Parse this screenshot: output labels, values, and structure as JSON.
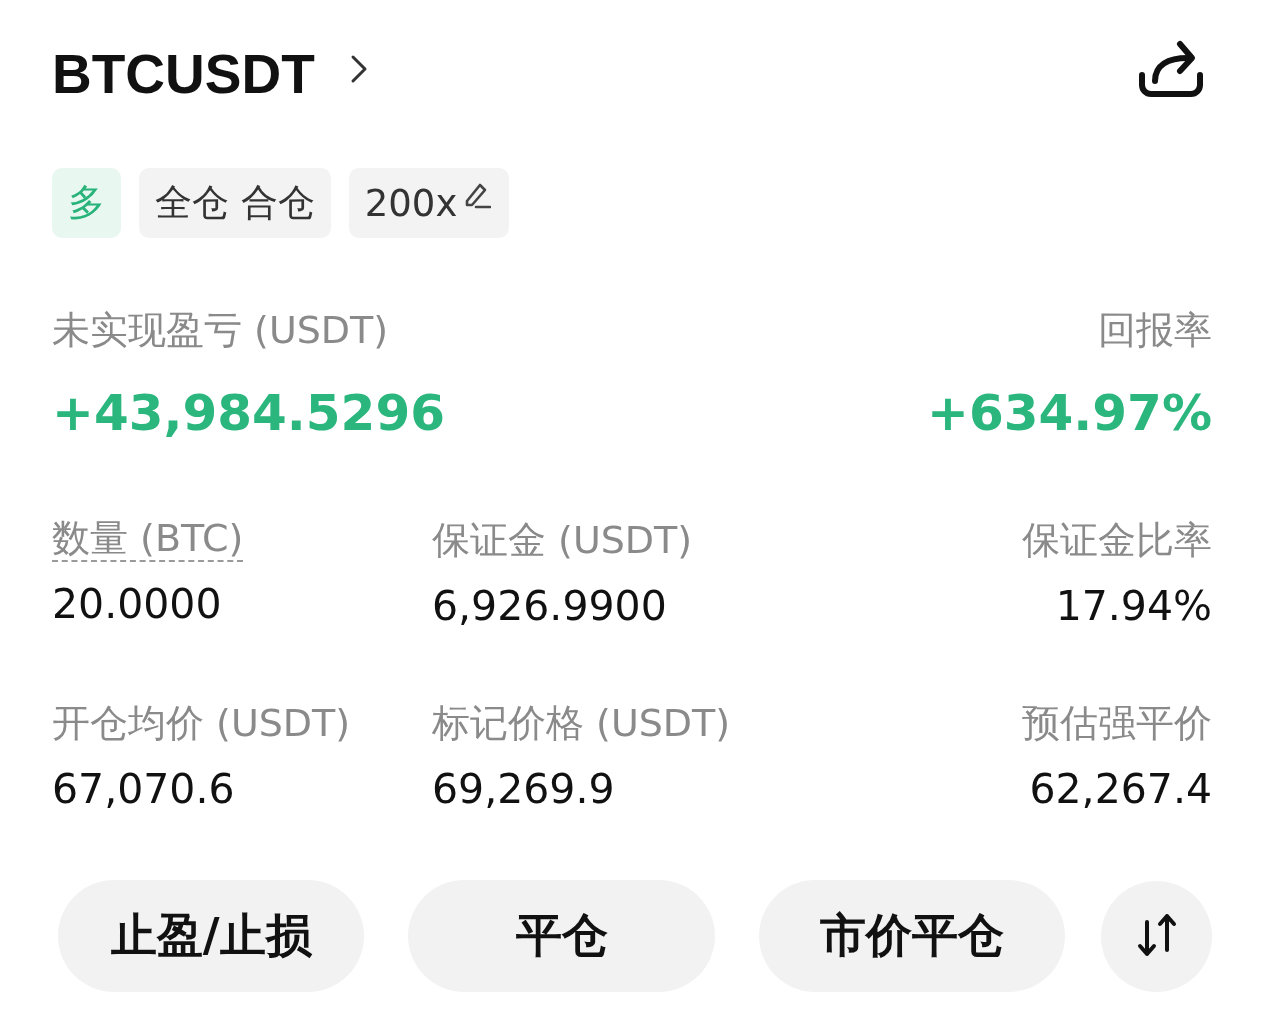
{
  "header": {
    "symbol": "BTCUSDT"
  },
  "tags": [
    {
      "kind": "side",
      "label": "多"
    },
    {
      "kind": "mode",
      "label": "全仓 合仓"
    },
    {
      "kind": "leverage",
      "label": "200x"
    }
  ],
  "summary": [
    {
      "label": "未实现盈亏 (USDT)",
      "value": "+43,984.5296"
    },
    {
      "label": "回报率",
      "value": "+634.97%"
    }
  ],
  "stats": [
    {
      "label": "数量 (BTC)",
      "value": "20.0000",
      "dashed_underline": true
    },
    {
      "label": "保证金 (USDT)",
      "value": "6,926.9900",
      "dashed_underline": false
    },
    {
      "label": "保证金比率",
      "value": "17.94%",
      "dashed_underline": false
    },
    {
      "label": "开仓均价 (USDT)",
      "value": "67,070.6",
      "dashed_underline": false
    },
    {
      "label": "标记价格 (USDT)",
      "value": "69,269.9",
      "dashed_underline": false
    },
    {
      "label": "预估强平价",
      "value": "62,267.4",
      "dashed_underline": false
    }
  ],
  "actions": [
    {
      "kind": "text",
      "label": "止盈/止损"
    },
    {
      "kind": "text",
      "label": "平仓"
    },
    {
      "kind": "text",
      "label": "市价平仓"
    },
    {
      "kind": "swap"
    }
  ]
}
